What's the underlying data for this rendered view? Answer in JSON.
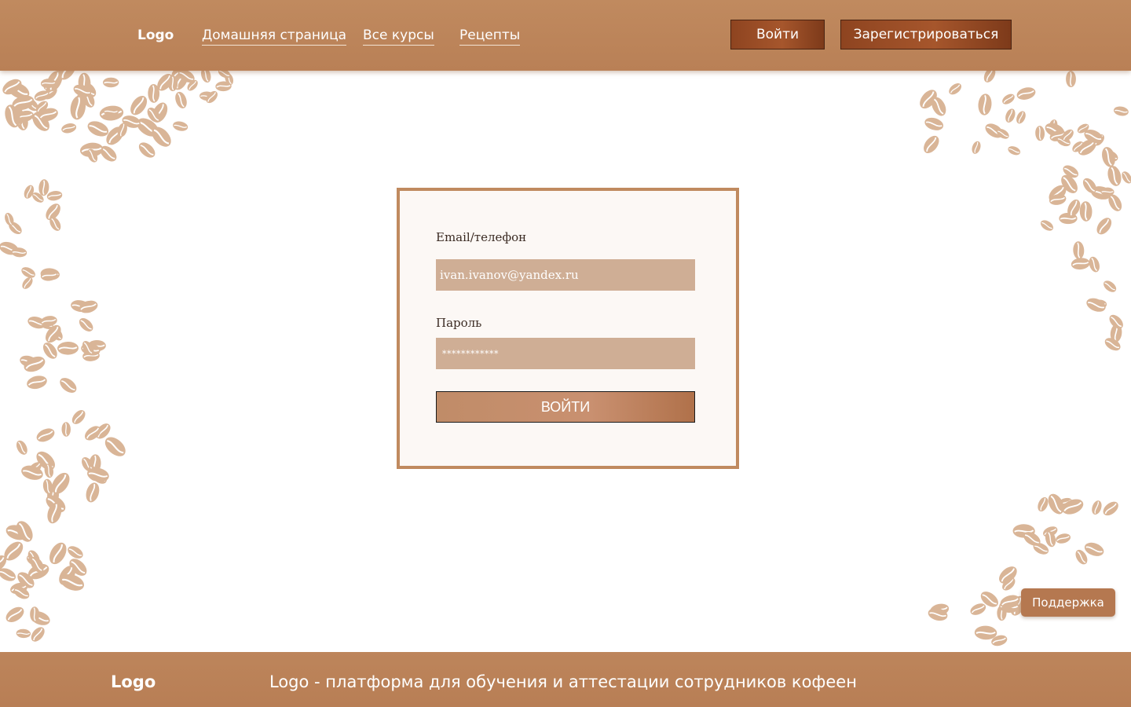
{
  "header": {
    "logo": "Logo",
    "nav": [
      {
        "label": "Домашняя страница"
      },
      {
        "label": "Все курсы"
      },
      {
        "label": "Рецепты"
      }
    ],
    "login_label": "Войти",
    "register_label": "Зарегистрироваться"
  },
  "login_form": {
    "email_label": "Email/телефон",
    "email_value": "ivan.ivanov@yandex.ru",
    "password_label": "Пароль",
    "password_value": "************",
    "submit_label": "ВОЙТИ"
  },
  "support_label": "Поддержка",
  "footer": {
    "logo": "Logo",
    "tagline": "Logo - платформа для обучения и аттестации сотрудников кофеен"
  },
  "colors": {
    "header": "#bd855b",
    "bean": "#d9b597",
    "card_border": "#c08a5f",
    "field": "#cfae95",
    "button_dark": "#8e4420"
  },
  "icons": [
    "coffee-bean-icon"
  ]
}
